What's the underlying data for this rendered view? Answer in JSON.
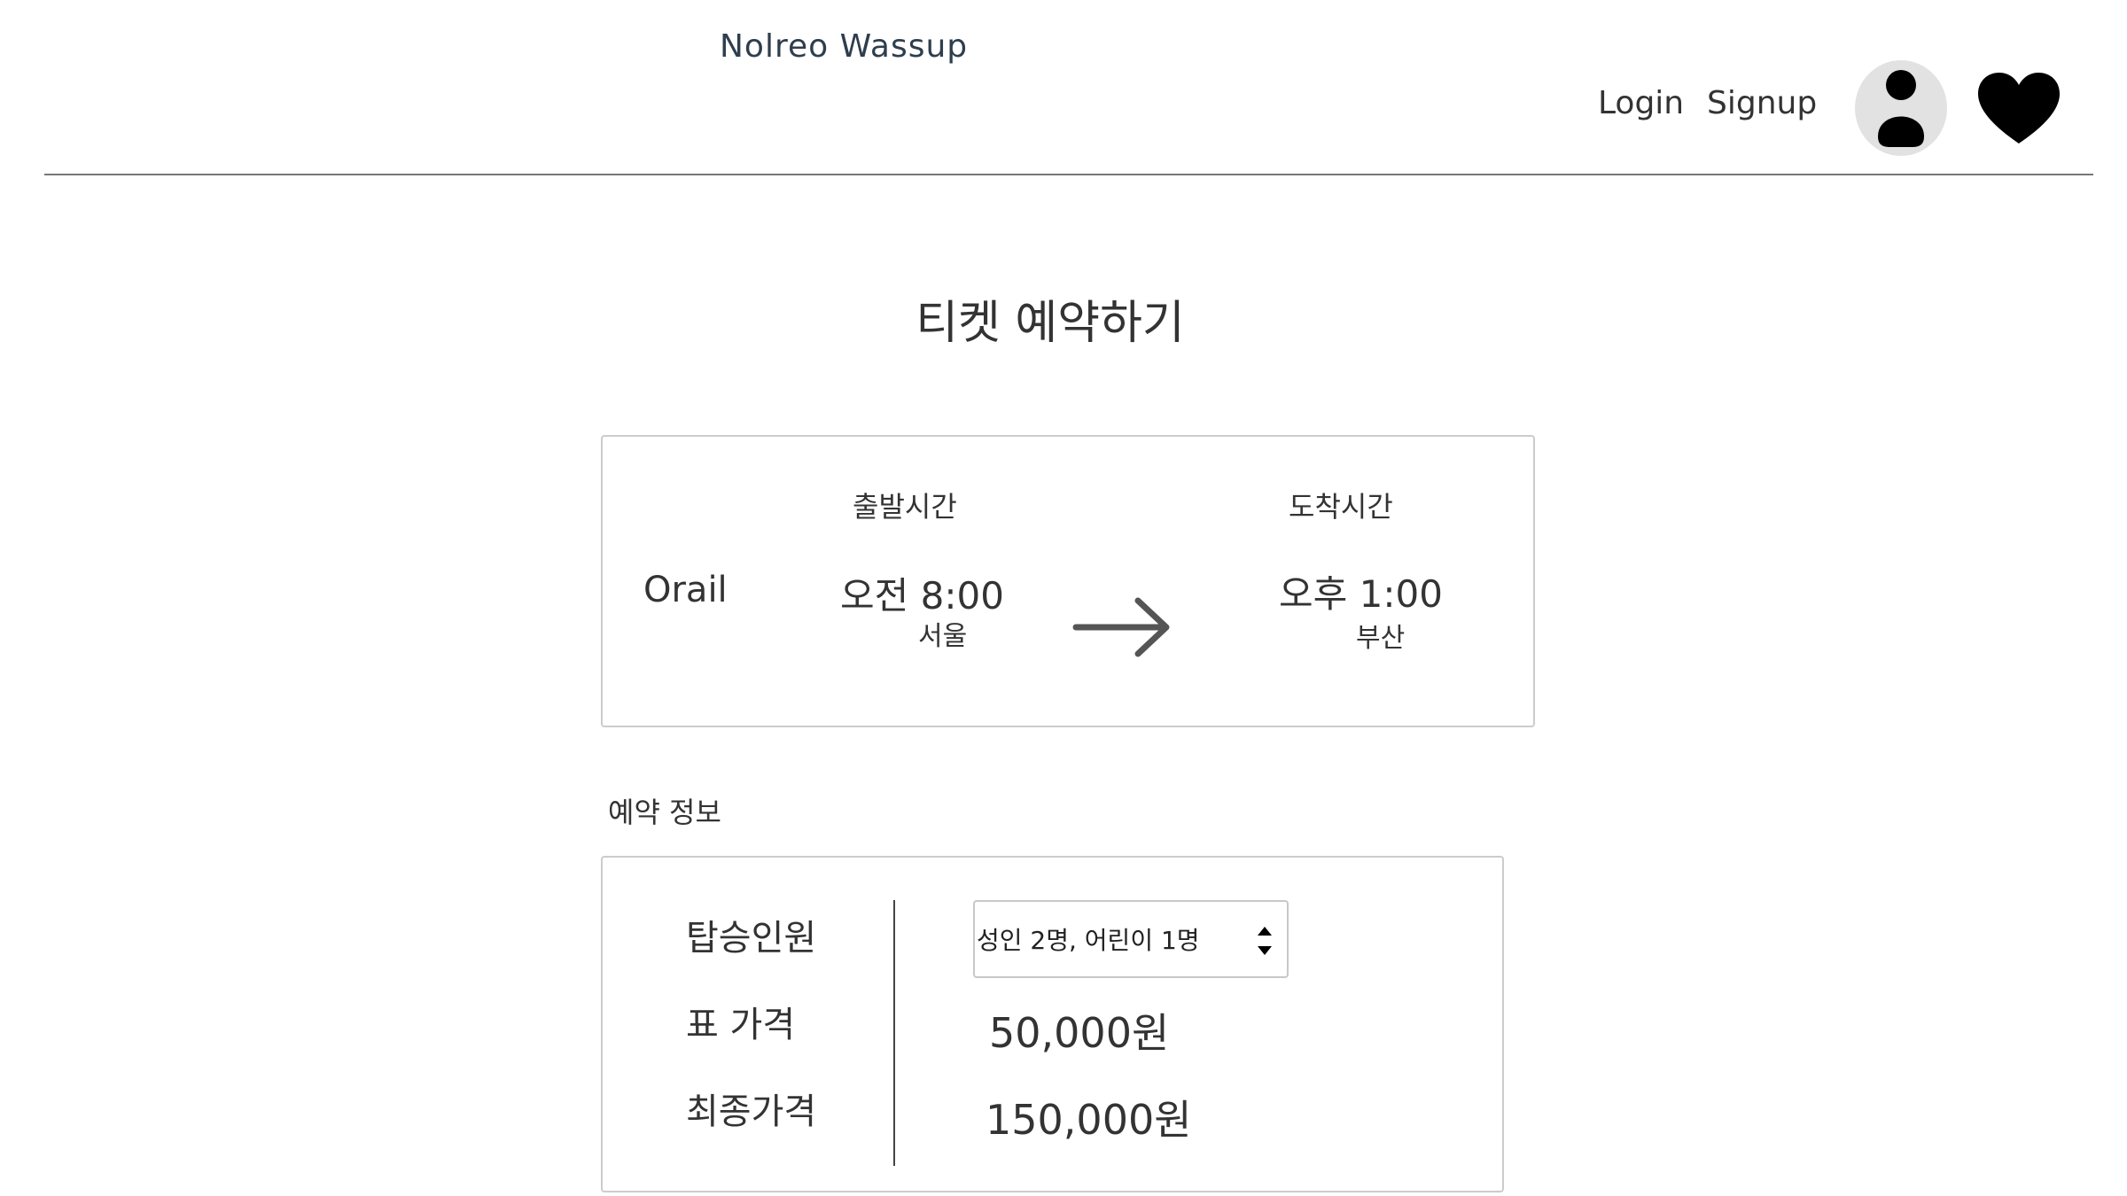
{
  "header": {
    "brand": "Nolreo Wassup",
    "login_label": "Login",
    "signup_label": "Signup",
    "profile_icon": "person-icon",
    "favorite_icon": "heart-icon"
  },
  "page": {
    "title": "티켓 예약하기"
  },
  "ticket": {
    "carrier": "Orail",
    "departure": {
      "label": "출발시간",
      "time": "오전 8:00",
      "city": "서울"
    },
    "arrival": {
      "label": "도착시간",
      "time": "오후 1:00",
      "city": "부산"
    },
    "arrow_icon": "arrow-right-icon"
  },
  "reservation": {
    "section_label": "예약 정보",
    "passengers_label": "탑승인원",
    "passengers_value": "성인 2명, 어린이 1명",
    "ticket_price_label": "표 가격",
    "ticket_price_value": "50,000원",
    "total_price_label": "최종가격",
    "total_price_value": "150,000원"
  }
}
